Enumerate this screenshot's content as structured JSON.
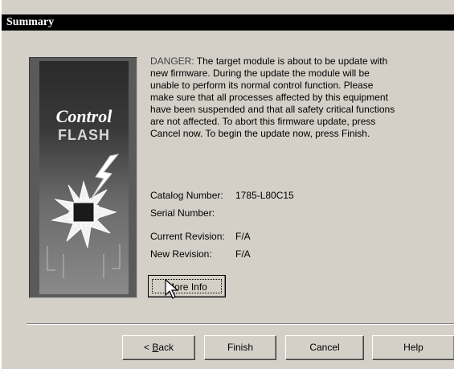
{
  "window": {
    "title": "Summary"
  },
  "logo": {
    "line1": "Control",
    "line2": "FLASH"
  },
  "message": {
    "danger_prefix": "DANGER:",
    "body": " The target module is about to be update with new firmware. During the update the module will be unable to perform its normal control function. Please make sure that all processes affected by this equipment have been suspended and that all safety critical functions are not affected. To abort this firmware update, press Cancel now. To begin the update now, press Finish."
  },
  "fields": {
    "catalog_label": "Catalog Number:",
    "catalog_value": "1785-L80C15",
    "serial_label": "Serial Number:",
    "serial_value": "",
    "current_rev_label": "Current Revision:",
    "current_rev_value": "F/A",
    "new_rev_label": "New Revision:",
    "new_rev_value": "F/A"
  },
  "buttons": {
    "more_info": "More Info",
    "back_prefix": "< ",
    "back_underlined": "B",
    "back_rest": "ack",
    "finish": "Finish",
    "cancel": "Cancel",
    "help": "Help"
  }
}
